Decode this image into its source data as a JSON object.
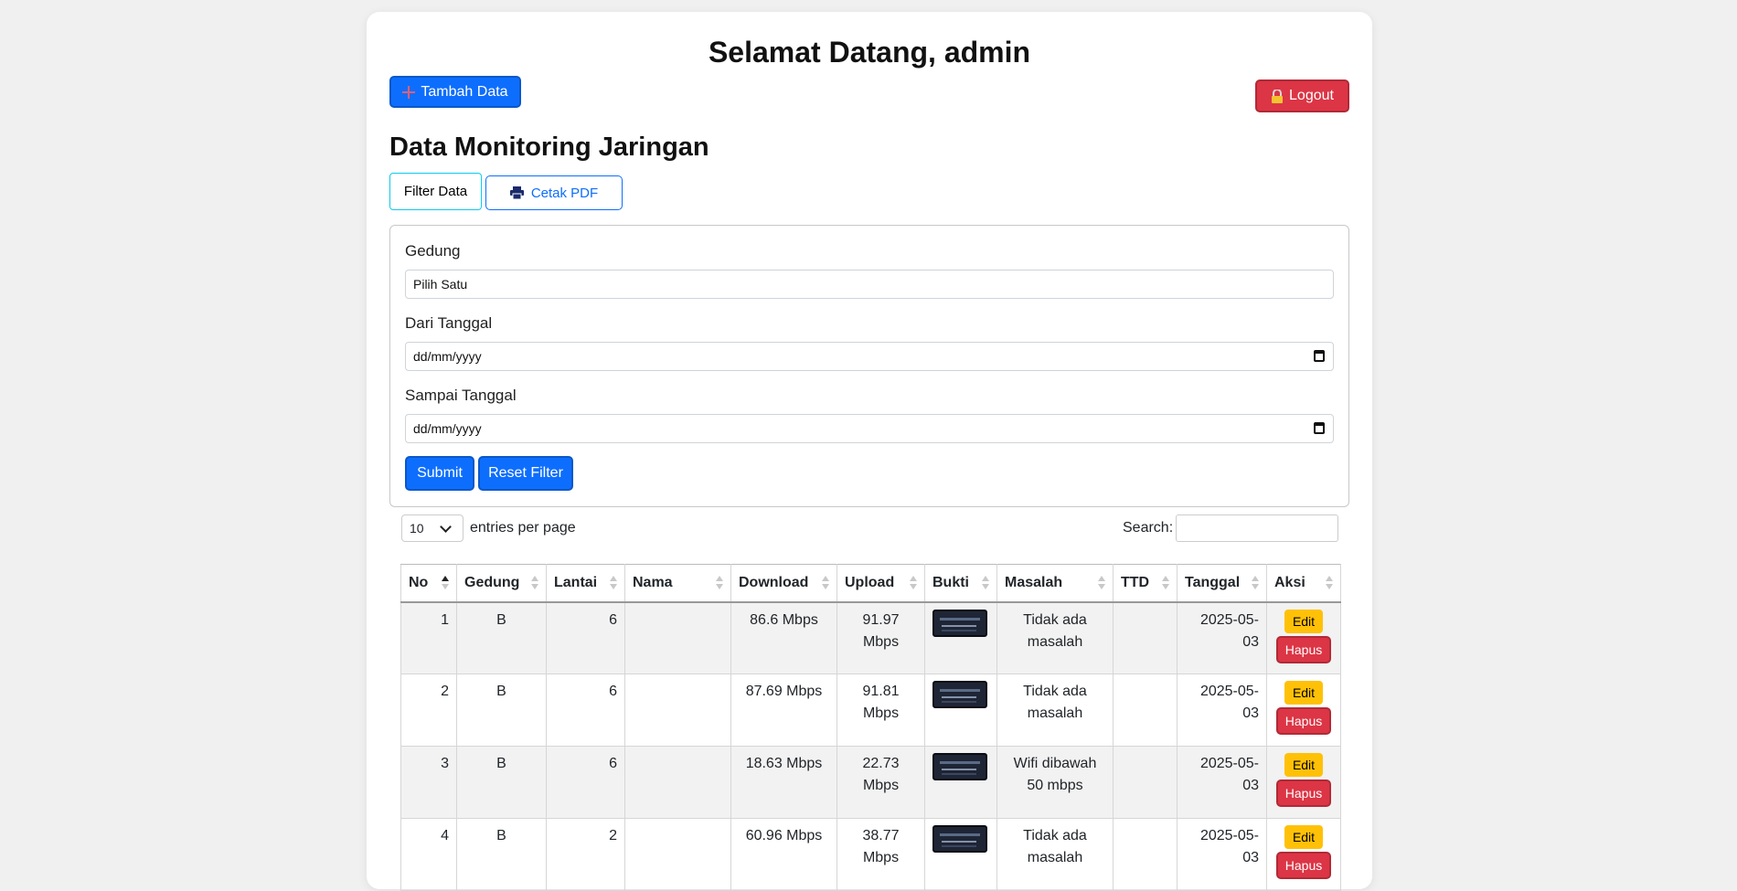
{
  "header": {
    "welcome": "Selamat Datang, admin"
  },
  "actions": {
    "add_label": "Tambah Data",
    "logout_label": "Logout"
  },
  "section": {
    "title": "Data Monitoring Jaringan"
  },
  "tabs": {
    "filter_label": "Filter Data",
    "print_label": "Cetak PDF"
  },
  "filter": {
    "gedung_label": "Gedung",
    "gedung_value": "Pilih Satu",
    "dari_label": "Dari Tanggal",
    "dari_value": "dd/mm/yyyy",
    "sampai_label": "Sampai Tanggal",
    "sampai_value": "dd/mm/yyyy",
    "submit_label": "Submit",
    "reset_label": "Reset Filter"
  },
  "table_controls": {
    "entries_value": "10",
    "entries_label": "entries per page",
    "search_label": "Search:"
  },
  "table": {
    "columns": [
      "No",
      "Gedung",
      "Lantai",
      "Nama",
      "Download",
      "Upload",
      "Bukti",
      "Masalah",
      "TTD",
      "Tanggal",
      "Aksi"
    ],
    "rows": [
      {
        "no": "1",
        "gedung": "B",
        "lantai": "6",
        "nama": "",
        "download": "86.6 Mbps",
        "upload": "91.97 Mbps",
        "masalah": "Tidak ada masalah",
        "ttd": "",
        "tanggal": "2025-05-03"
      },
      {
        "no": "2",
        "gedung": "B",
        "lantai": "6",
        "nama": "",
        "download": "87.69 Mbps",
        "upload": "91.81 Mbps",
        "masalah": "Tidak ada masalah",
        "ttd": "",
        "tanggal": "2025-05-03"
      },
      {
        "no": "3",
        "gedung": "B",
        "lantai": "6",
        "nama": "",
        "download": "18.63 Mbps",
        "upload": "22.73 Mbps",
        "masalah": "Wifi dibawah 50 mbps",
        "ttd": "",
        "tanggal": "2025-05-03"
      },
      {
        "no": "4",
        "gedung": "B",
        "lantai": "2",
        "nama": "",
        "download": "60.96 Mbps",
        "upload": "38.77 Mbps",
        "masalah": "Tidak ada masalah",
        "ttd": "",
        "tanggal": "2025-05-03"
      }
    ],
    "edit_label": "Edit",
    "delete_label": "Hapus"
  },
  "colors": {
    "primary": "#0d6efd",
    "danger": "#dc3545",
    "warning": "#ffc107",
    "info": "#0dcaf0"
  },
  "icons": {
    "add": "plus-icon",
    "logout": "lock-icon",
    "print": "printer-icon",
    "calendar": "calendar-icon",
    "dropdown": "chevron-down-icon",
    "sort": "sort-icon"
  }
}
